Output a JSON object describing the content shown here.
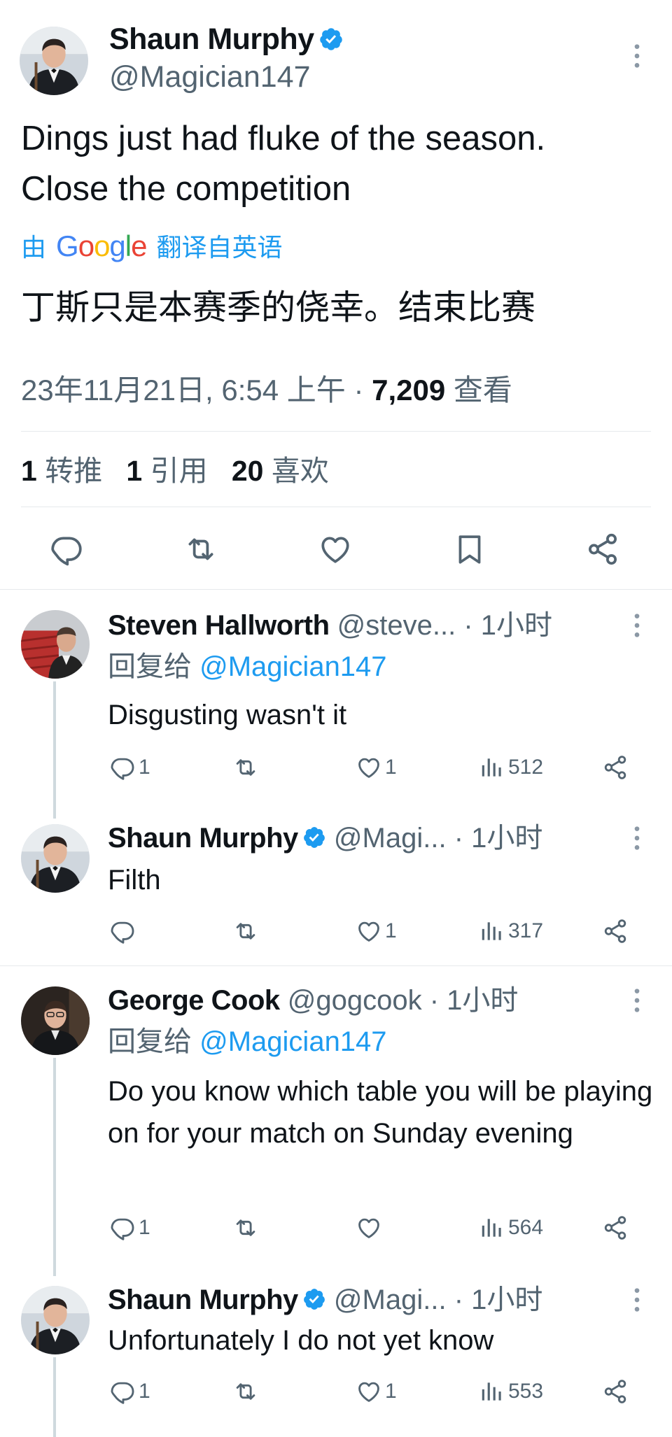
{
  "main_tweet": {
    "author_name": "Shaun Murphy",
    "author_handle": "@Magician147",
    "text_line1": "Dings just had fluke of the season.",
    "text_line2": "Close the competition",
    "translate_prefix": "由",
    "translate_brand": "Google",
    "translate_suffix": "翻译自英语",
    "translated_text": "丁斯只是本赛季的侥幸。结束比赛",
    "timestamp": "23年11月21日, 6:54 上午",
    "dot": "·",
    "views_count": "7,209",
    "views_label": "查看",
    "retweets_count": "1",
    "retweets_label": "转推",
    "quotes_count": "1",
    "quotes_label": "引用",
    "likes_count": "20",
    "likes_label": "喜欢"
  },
  "replies": [
    {
      "name": "Steven Hallworth",
      "handle": "@steve...",
      "time": "· 1小时",
      "reply_prefix": "回复给",
      "reply_mention": "@Magician147",
      "text": "Disgusting wasn't it",
      "replies": "1",
      "likes": "1",
      "views": "512"
    },
    {
      "name": "Shaun Murphy",
      "handle": "@Magi...",
      "time": "· 1小时",
      "text": "Filth",
      "replies": "",
      "likes": "1",
      "views": "317"
    },
    {
      "name": "George Cook",
      "handle": "@gogcook",
      "time": "· 1小时",
      "reply_prefix": "回复给",
      "reply_mention": "@Magician147",
      "text": "Do you know which table you will be playing on for your match on Sunday evening",
      "replies": "1",
      "likes": "",
      "views": "564"
    },
    {
      "name": "Shaun Murphy",
      "handle": "@Magi...",
      "time": "· 1小时",
      "text": "Unfortunately I do not yet know",
      "replies": "1",
      "likes": "1",
      "views": "553"
    }
  ],
  "colors": {
    "accent": "#1d9bf0",
    "text": "#0f1419",
    "secondary": "#536471",
    "divider": "#e6e9ec"
  },
  "icons": [
    "verified-badge-icon",
    "more-icon",
    "reply-icon",
    "retweet-icon",
    "like-icon",
    "bookmark-icon",
    "share-icon",
    "views-icon"
  ]
}
